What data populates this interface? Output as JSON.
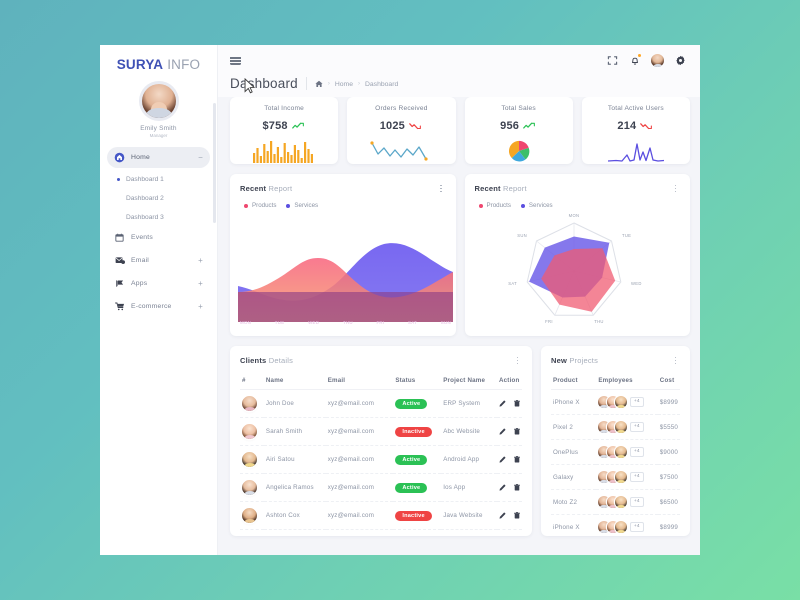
{
  "sidebar": {
    "brand": {
      "bold": "SURYA",
      "light": "INFO"
    },
    "profile": {
      "name": "Emily Smith",
      "role": "Manager"
    },
    "items": [
      {
        "label": "Home",
        "icon": "home-icon",
        "active": true,
        "expander": "−"
      },
      {
        "label": "Dashboard 1",
        "sub": true,
        "current": true
      },
      {
        "label": "Dashboard 2",
        "sub": true,
        "current": false
      },
      {
        "label": "Dashboard 3",
        "sub": true,
        "current": false
      },
      {
        "label": "Events",
        "icon": "calendar-icon",
        "expander": ""
      },
      {
        "label": "Email",
        "icon": "mail-icon",
        "expander": "+"
      },
      {
        "label": "Apps",
        "icon": "apps-icon",
        "expander": "+"
      },
      {
        "label": "E-commerce",
        "icon": "cart-icon",
        "expander": "+"
      }
    ]
  },
  "header": {
    "menu_icon": "hamburger-icon",
    "title": "Dashboard",
    "breadcrumb": {
      "home_icon": "home-icon",
      "sep": "›",
      "items": [
        "Home",
        "Dashboard"
      ]
    },
    "icons": [
      "fullscreen-icon",
      "bell-icon",
      "avatar",
      "gear-icon"
    ]
  },
  "stats": [
    {
      "label": "Total Income",
      "value": "$758",
      "trend": "up",
      "spark": "bars"
    },
    {
      "label": "Orders Received",
      "value": "1025",
      "trend": "down",
      "spark": "line"
    },
    {
      "label": "Total Sales",
      "value": "956",
      "trend": "up",
      "spark": "pie"
    },
    {
      "label": "Total Active Users",
      "value": "214",
      "trend": "down",
      "spark": "spike"
    }
  ],
  "charts": [
    {
      "title_bold": "Recent",
      "title_light": "Report",
      "legend": [
        {
          "label": "Products",
          "color": "#ef476f"
        },
        {
          "label": "Services",
          "color": "#5b4fe0"
        }
      ]
    },
    {
      "title_bold": "Recent",
      "title_light": "Report",
      "legend": [
        {
          "label": "Products",
          "color": "#ef476f"
        },
        {
          "label": "Services",
          "color": "#5b4fe0"
        }
      ]
    }
  ],
  "chart_data": [
    {
      "type": "area",
      "title": "Recent Report",
      "categories": [
        "MON",
        "TUE",
        "WED",
        "THU",
        "FRI",
        "SAT",
        "SUN"
      ],
      "series": [
        {
          "name": "Products",
          "color": "#ef476f",
          "values": [
            28,
            52,
            78,
            50,
            22,
            30,
            58
          ]
        },
        {
          "name": "Services",
          "color": "#5b4fe0",
          "values": [
            42,
            30,
            26,
            34,
            62,
            84,
            70
          ]
        }
      ],
      "xlabel": "",
      "ylabel": "",
      "ylim": [
        0,
        100
      ],
      "grid": false,
      "legend_position": "top-left"
    },
    {
      "type": "radar",
      "title": "Recent Report",
      "categories": [
        "MON",
        "TUE",
        "WED",
        "THU",
        "FRI",
        "SAT",
        "SUN"
      ],
      "series": [
        {
          "name": "Products",
          "color": "#ef476f",
          "values": [
            60,
            76,
            88,
            92,
            76,
            70,
            52
          ]
        },
        {
          "name": "Services",
          "color": "#5b4fe0",
          "values": [
            72,
            94,
            60,
            58,
            60,
            96,
            78
          ]
        }
      ],
      "ylim": [
        0,
        100
      ],
      "grid": true,
      "legend_position": "top-left"
    }
  ],
  "clients": {
    "title_bold": "Clients",
    "title_light": "Details",
    "columns": [
      "#",
      "Name",
      "Email",
      "Status",
      "Project Name",
      "Action"
    ],
    "rows": [
      {
        "name": "John Doe",
        "email": "xyz@email.com",
        "status": "Active",
        "project": "ERP System"
      },
      {
        "name": "Sarah Smith",
        "email": "xyz@email.com",
        "status": "Inactive",
        "project": "Abc Website"
      },
      {
        "name": "Airi Satou",
        "email": "xyz@email.com",
        "status": "Active",
        "project": "Android App"
      },
      {
        "name": "Angelica Ramos",
        "email": "xyz@email.com",
        "status": "Active",
        "project": "Ios App"
      },
      {
        "name": "Ashton Cox",
        "email": "xyz@email.com",
        "status": "Inactive",
        "project": "Java Website"
      }
    ],
    "action_icons": [
      "edit-icon",
      "delete-icon"
    ]
  },
  "projects": {
    "title_bold": "New",
    "title_light": "Projects",
    "columns": [
      "Product",
      "Employees",
      "Cost"
    ],
    "rows": [
      {
        "product": "iPhone X",
        "more": "+4",
        "cost": "$8999"
      },
      {
        "product": "Pixel 2",
        "more": "+4",
        "cost": "$5550"
      },
      {
        "product": "OnePlus",
        "more": "+4",
        "cost": "$9000"
      },
      {
        "product": "Galaxy",
        "more": "+4",
        "cost": "$7500"
      },
      {
        "product": "Moto Z2",
        "more": "+4",
        "cost": "$6500"
      },
      {
        "product": "iPhone X",
        "more": "+4",
        "cost": "$8999"
      }
    ]
  },
  "colors": {
    "accent_blue": "#3f51b5",
    "status_active": "#2bc155",
    "status_inactive": "#ef4444",
    "trend_up": "#2bc155",
    "trend_down": "#ef4444",
    "products": "#ef476f",
    "services": "#5b4fe0",
    "income_bars": "#f5a623",
    "background_start": "#5fb2bd",
    "background_end": "#79dfa6"
  }
}
